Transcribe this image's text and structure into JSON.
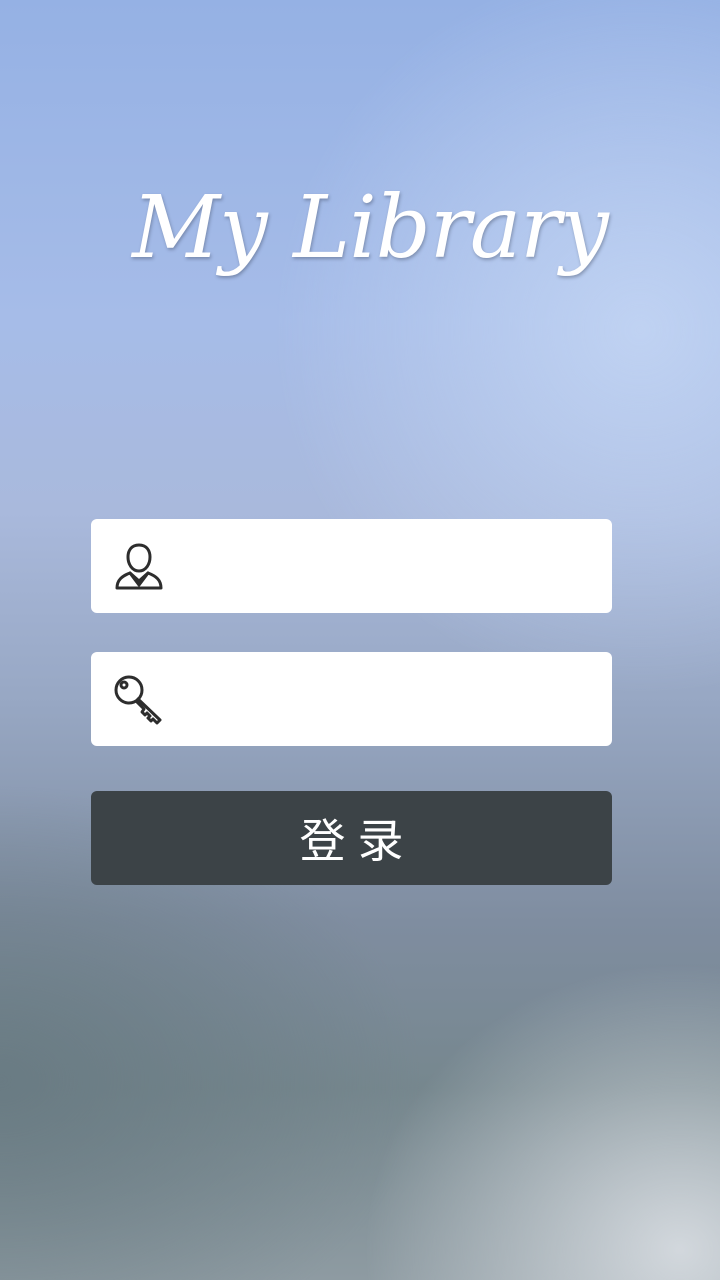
{
  "app": {
    "title": "My Library"
  },
  "form": {
    "username": {
      "icon": "user-icon",
      "value": "",
      "placeholder": ""
    },
    "password": {
      "icon": "key-icon",
      "value": "",
      "placeholder": ""
    },
    "login_label": "登录"
  },
  "colors": {
    "button_background": "#3c4347",
    "field_background": "#ffffff",
    "title_color": "#ffffff"
  }
}
